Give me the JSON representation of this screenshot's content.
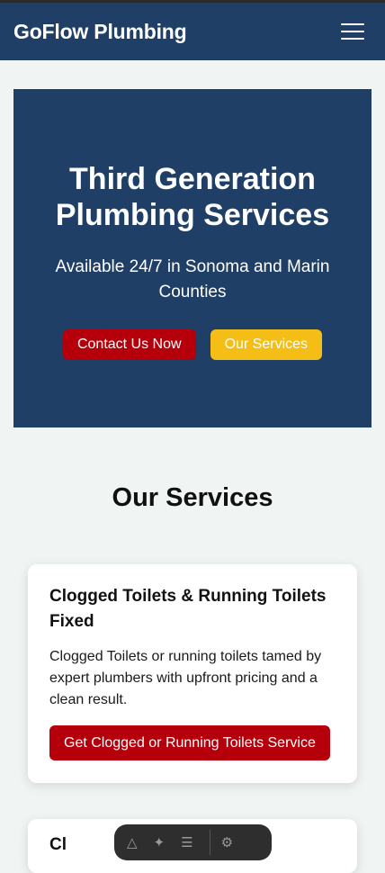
{
  "header": {
    "brand": "GoFlow Plumbing",
    "menu_icon": "hamburger-menu-icon"
  },
  "hero": {
    "title": "Third Generation Plumbing Services",
    "subtitle": "Available 24/7 in Sonoma and Marin Counties",
    "primary_button": "Contact Us Now",
    "secondary_button": "Our Services"
  },
  "services": {
    "title": "Our Services",
    "cards": [
      {
        "title": "Clogged Toilets & Running Toilets Fixed",
        "description": "Clogged Toilets or running toilets tamed by expert plumbers with upfront pricing and a clean result.",
        "button": "Get Clogged or Running Toilets Service"
      },
      {
        "title": "Cl"
      }
    ]
  },
  "colors": {
    "navy": "#1f3f66",
    "red": "#b5000c",
    "yellow": "#f5be17",
    "background": "#f0f4f2"
  }
}
